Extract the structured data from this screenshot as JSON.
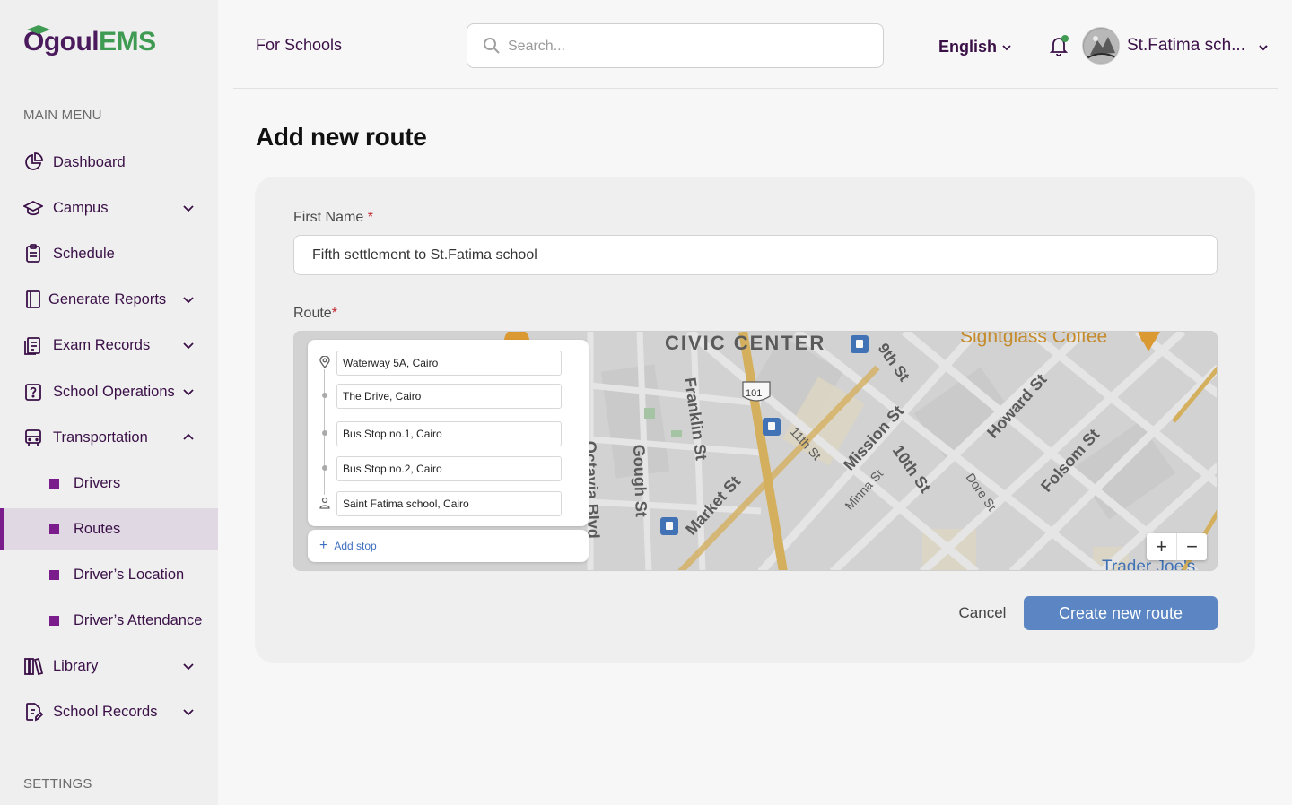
{
  "app": {
    "logo_part1": "Ogoul",
    "logo_part2": "EMS"
  },
  "sidebar": {
    "main_menu_heading": "MAIN MENU",
    "settings_heading": "SETTINGS",
    "items": [
      {
        "label": "Dashboard",
        "icon": "pie-chart-icon"
      },
      {
        "label": "Campus",
        "icon": "graduation-cap-icon"
      },
      {
        "label": "Schedule",
        "icon": "clipboard-icon"
      },
      {
        "label": "Generate Reports",
        "icon": "book-icon"
      },
      {
        "label": "Exam Records",
        "icon": "document-list-icon"
      },
      {
        "label": "School Operations",
        "icon": "question-folder-icon"
      },
      {
        "label": "Transportation",
        "icon": "bus-icon"
      },
      {
        "label": "Library",
        "icon": "library-icon"
      },
      {
        "label": "School Records",
        "icon": "file-edit-icon"
      }
    ],
    "transport_sub": [
      {
        "label": "Drivers"
      },
      {
        "label": "Routes"
      },
      {
        "label": "Driver’s Location"
      },
      {
        "label": "Driver’s Attendance"
      }
    ]
  },
  "header": {
    "for_schools": "For Schools",
    "search_placeholder": "Search...",
    "language": "English",
    "user_name": "St.Fatima sch..."
  },
  "page": {
    "title": "Add new route",
    "first_name_label": "First Name",
    "first_name_value": "Fifth settlement to St.Fatima school",
    "route_label": "Route",
    "required_mark": "*"
  },
  "route": {
    "stops": [
      "Waterway 5A, Cairo",
      "The Drive, Cairo",
      "Bus Stop no.1, Cairo",
      "Bus Stop no.2, Cairo",
      "Saint Fatima school, Cairo"
    ],
    "add_stop": "Add stop"
  },
  "map": {
    "labels": {
      "civic_center": "CIVIC CENTER",
      "coffee": "Sightglass Coffee",
      "ninth": "9th St",
      "franklin": "Franklin St",
      "gough": "Gough St",
      "octavia": "Octavia Blvd",
      "market": "Market St",
      "eleventh": "11th St",
      "mission": "Mission St",
      "minna": "Minna St",
      "tenth": "10th St",
      "howard": "Howard St",
      "dore": "Dore St",
      "folsom": "Folsom St",
      "hwy": "101",
      "trader": "Trader Joe's"
    },
    "zoom_in": "+",
    "zoom_out": "−"
  },
  "actions": {
    "cancel": "Cancel",
    "create": "Create new route"
  }
}
